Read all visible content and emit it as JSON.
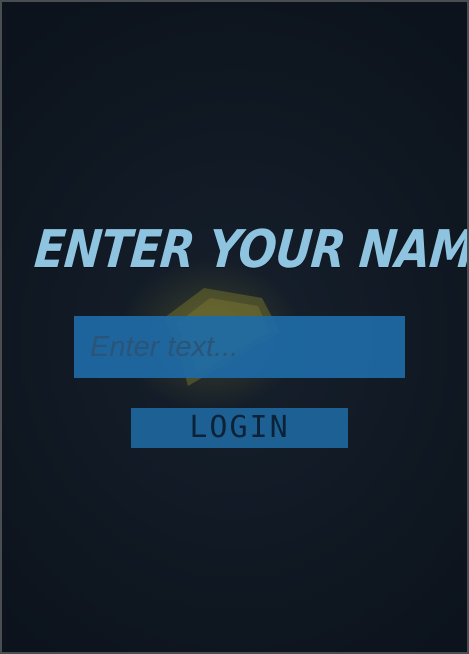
{
  "title": "ENTER YOUR NAME",
  "name_input": {
    "value": "",
    "placeholder": "Enter text..."
  },
  "login_button": {
    "label": "LOGIN"
  },
  "colors": {
    "background": "#0c131c",
    "title": "#8ec4e0",
    "input_background": "#1e6aa6",
    "button_background": "#1d6194",
    "button_text": "#0b2238",
    "glow": "#c8be46"
  },
  "decor": {
    "shard_icon": "glowing-yellow-shard"
  }
}
